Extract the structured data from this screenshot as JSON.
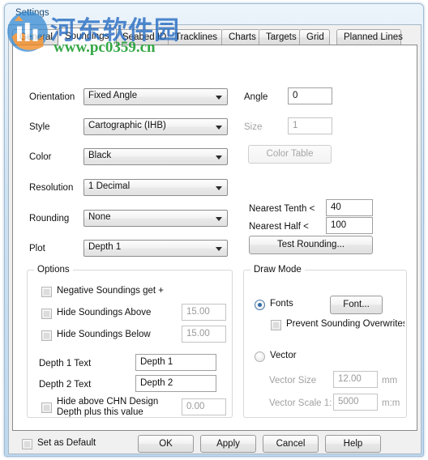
{
  "window": {
    "title": "Settings"
  },
  "tabs": [
    {
      "label": "General",
      "selected": false
    },
    {
      "label": "Soundings",
      "selected": true
    },
    {
      "label": "Seabed ID",
      "selected": false
    },
    {
      "label": "Tracklines",
      "selected": false
    },
    {
      "label": "Charts",
      "selected": false
    },
    {
      "label": "Targets",
      "selected": false
    },
    {
      "label": "Grid",
      "selected": false
    },
    {
      "label": "Planned Lines",
      "selected": false
    }
  ],
  "form": {
    "orientation": {
      "label": "Orientation",
      "value": "Fixed Angle"
    },
    "style": {
      "label": "Style",
      "value": "Cartographic (IHB)"
    },
    "color": {
      "label": "Color",
      "value": "Black"
    },
    "resolution": {
      "label": "Resolution",
      "value": "1 Decimal"
    },
    "rounding": {
      "label": "Rounding",
      "value": "None"
    },
    "plot": {
      "label": "Plot",
      "value": "Depth 1"
    },
    "angle": {
      "label": "Angle",
      "value": "0"
    },
    "size": {
      "label": "Size",
      "value": "1",
      "disabled": true
    },
    "color_table": {
      "label": "Color Table",
      "disabled": true
    },
    "nearest_tenth": {
      "label": "Nearest Tenth <",
      "value": "40"
    },
    "nearest_half": {
      "label": "Nearest Half <",
      "value": "100"
    },
    "test_rounding": {
      "label": "Test Rounding..."
    }
  },
  "options": {
    "title": "Options",
    "negative_soundings": {
      "label": "Negative Soundings get +",
      "checked": false
    },
    "hide_above": {
      "label": "Hide Soundings Above",
      "checked": false,
      "value": "15.00"
    },
    "hide_below": {
      "label": "Hide Soundings Below",
      "checked": false,
      "value": "15.00"
    },
    "depth1_text": {
      "label": "Depth 1 Text",
      "value": "Depth 1"
    },
    "depth2_text": {
      "label": "Depth 2 Text",
      "value": "Depth 2"
    },
    "hide_chn": {
      "label_line1": "Hide above CHN Design",
      "label_line2": "Depth plus this value",
      "checked": false,
      "value": "0.00"
    }
  },
  "draw_mode": {
    "title": "Draw Mode",
    "fonts": {
      "label": "Fonts",
      "selected": true
    },
    "font_button": {
      "label": "Font..."
    },
    "prevent_overwrite": {
      "label": "Prevent Sounding Overwrites",
      "checked": false
    },
    "vector": {
      "label": "Vector",
      "selected": false
    },
    "vector_size": {
      "label": "Vector Size",
      "value": "12.00",
      "unit": "mm",
      "disabled": true
    },
    "vector_scale": {
      "label": "Vector Scale 1:",
      "value": "5000",
      "unit": "m:m",
      "disabled": true
    }
  },
  "footer": {
    "set_as_default": {
      "label": "Set as Default",
      "checked": false
    },
    "ok": {
      "label": "OK"
    },
    "apply": {
      "label": "Apply"
    },
    "cancel": {
      "label": "Cancel"
    },
    "help": {
      "label": "Help"
    }
  },
  "watermark": {
    "site_name_cn": "河东软件园",
    "site_url": "www.pc0359.cn",
    "cn_color": "#2a6fc4",
    "url_color": "#1f9e33"
  }
}
